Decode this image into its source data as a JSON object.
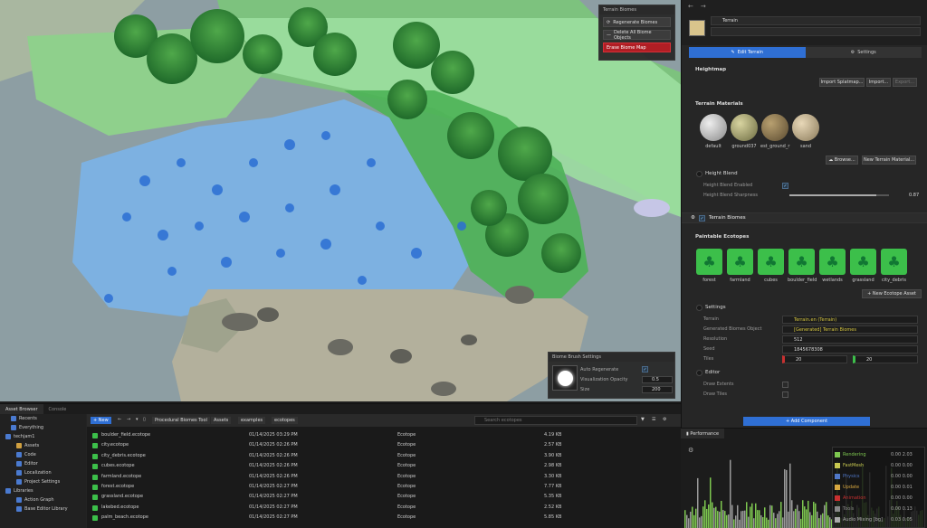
{
  "viewport": {
    "biomes_panel": {
      "title": "Terrain Biomes",
      "regenerate_label": "Regenerate Biomes",
      "delete_label": "Delete All Biome Objects",
      "erase_label": "Erase Biome Map"
    },
    "brush_panel": {
      "title": "Biome Brush Settings",
      "auto_regenerate_label": "Auto Regenerate",
      "auto_regenerate_checked": "✓",
      "vis_opacity_label": "Visualization Opacity",
      "vis_opacity_value": "0.5",
      "size_label": "Size",
      "size_value": "200"
    }
  },
  "inspector": {
    "entity_name": "Terrain",
    "tabs": {
      "edit": "Edit Terrain",
      "settings": "Settings"
    },
    "heightmap": {
      "title": "Heightmap",
      "import_splat": "Import Splatmap...",
      "import": "Import...",
      "export": "Export..."
    },
    "materials": {
      "title": "Terrain Materials",
      "items": [
        "default",
        "ground037",
        "est_ground_r",
        "sand"
      ],
      "browse": "Browse...",
      "new_material": "New Terrain Material..."
    },
    "height_blend": {
      "title": "Height Blend",
      "enabled_label": "Height Blend Enabled",
      "enabled_value": "✓",
      "sharpness_label": "Height Blend Sharpness",
      "sharpness_value": "0.87",
      "sharpness_fraction": 0.87
    },
    "biomes_section": "Terrain Biomes",
    "ecotopes": {
      "title": "Paintable Ecotopes",
      "items": [
        "forest",
        "farmland",
        "cubes",
        "boulder_field",
        "wetlands",
        "grassland",
        "city_debris"
      ],
      "new_asset": "New Ecotope Asset"
    },
    "settings": {
      "title": "Settings",
      "terrain_label": "Terrain",
      "terrain_value": "Terrain.en (Terrain)",
      "generated_label": "Generated Biomes Object",
      "generated_value": "[Generated] Terrain Biomes",
      "resolution_label": "Resolution",
      "resolution_value": "512",
      "seed_label": "Seed",
      "seed_value": "1845678308",
      "tiles_label": "Tiles",
      "tiles_x": "20",
      "tiles_y": "20"
    },
    "editor": {
      "title": "Editor",
      "draw_extents": "Draw Extents",
      "draw_tiles": "Draw Tiles"
    },
    "add_component": "Add Component"
  },
  "asset_browser": {
    "tabs": [
      "Asset Browser",
      "Console"
    ],
    "sidebar": [
      {
        "label": "Recents",
        "indent": 1,
        "color": "#4a7ad0"
      },
      {
        "label": "Everything",
        "indent": 1,
        "color": "#4a7ad0"
      },
      {
        "label": "techjam1",
        "indent": 0,
        "color": "#4a7ad0"
      },
      {
        "label": "Assets",
        "indent": 2,
        "color": "#d0a040"
      },
      {
        "label": "Code",
        "indent": 2,
        "color": "#4a7ad0"
      },
      {
        "label": "Editor",
        "indent": 2,
        "color": "#4a7ad0"
      },
      {
        "label": "Localization",
        "indent": 2,
        "color": "#4a7ad0"
      },
      {
        "label": "Project Settings",
        "indent": 2,
        "color": "#4a7ad0"
      },
      {
        "label": "Libraries",
        "indent": 0,
        "color": "#4a7ad0"
      },
      {
        "label": "Action Graph",
        "indent": 2,
        "color": "#4a7ad0"
      },
      {
        "label": "Base Editor Library",
        "indent": 2,
        "color": "#4a7ad0"
      }
    ],
    "toolbar": {
      "new_label": "New",
      "path": [
        "Procedural Biomes Tool",
        "Assets",
        "examples",
        "ecotopes"
      ],
      "search_placeholder": "Search ecotopes"
    },
    "files": [
      {
        "name": "boulder_field.ecotope",
        "date": "01/14/2025 03:29 PM",
        "type": "Ecotope",
        "size": "4.19 KB"
      },
      {
        "name": "city.ecotope",
        "date": "01/14/2025 02:26 PM",
        "type": "Ecotope",
        "size": "2.57 KB"
      },
      {
        "name": "city_debris.ecotope",
        "date": "01/14/2025 02:26 PM",
        "type": "Ecotope",
        "size": "3.90 KB"
      },
      {
        "name": "cubes.ecotope",
        "date": "01/14/2025 02:26 PM",
        "type": "Ecotope",
        "size": "2.98 KB"
      },
      {
        "name": "farmland.ecotope",
        "date": "01/14/2025 02:26 PM",
        "type": "Ecotope",
        "size": "3.30 KB"
      },
      {
        "name": "forest.ecotope",
        "date": "01/14/2025 02:27 PM",
        "type": "Ecotope",
        "size": "7.77 KB"
      },
      {
        "name": "grassland.ecotope",
        "date": "01/14/2025 02:27 PM",
        "type": "Ecotope",
        "size": "5.35 KB"
      },
      {
        "name": "lakebed.ecotope",
        "date": "01/14/2025 02:27 PM",
        "type": "Ecotope",
        "size": "2.52 KB"
      },
      {
        "name": "palm_beach.ecotope",
        "date": "01/14/2025 02:27 PM",
        "type": "Ecotope",
        "size": "5.85 KB"
      }
    ]
  },
  "performance": {
    "title": "Performance",
    "legend": [
      {
        "label": "Rendering",
        "color": "#7ec850",
        "value": "0.00 2.03"
      },
      {
        "label": "FastMesh",
        "color": "#c8c850",
        "value": "0.00 0.00"
      },
      {
        "label": "Physics",
        "color": "#5078c8",
        "value": "0.00 0.00"
      },
      {
        "label": "Update",
        "color": "#d8a840",
        "value": "0.00 0.01"
      },
      {
        "label": "Animation",
        "color": "#c83030",
        "value": "0.00 0.00"
      },
      {
        "label": "Tools",
        "color": "#888888",
        "value": "0.00 0.13"
      },
      {
        "label": "Audio Mixing [bg]",
        "color": "#aaaaaa",
        "value": "0.03 0.05"
      }
    ]
  }
}
